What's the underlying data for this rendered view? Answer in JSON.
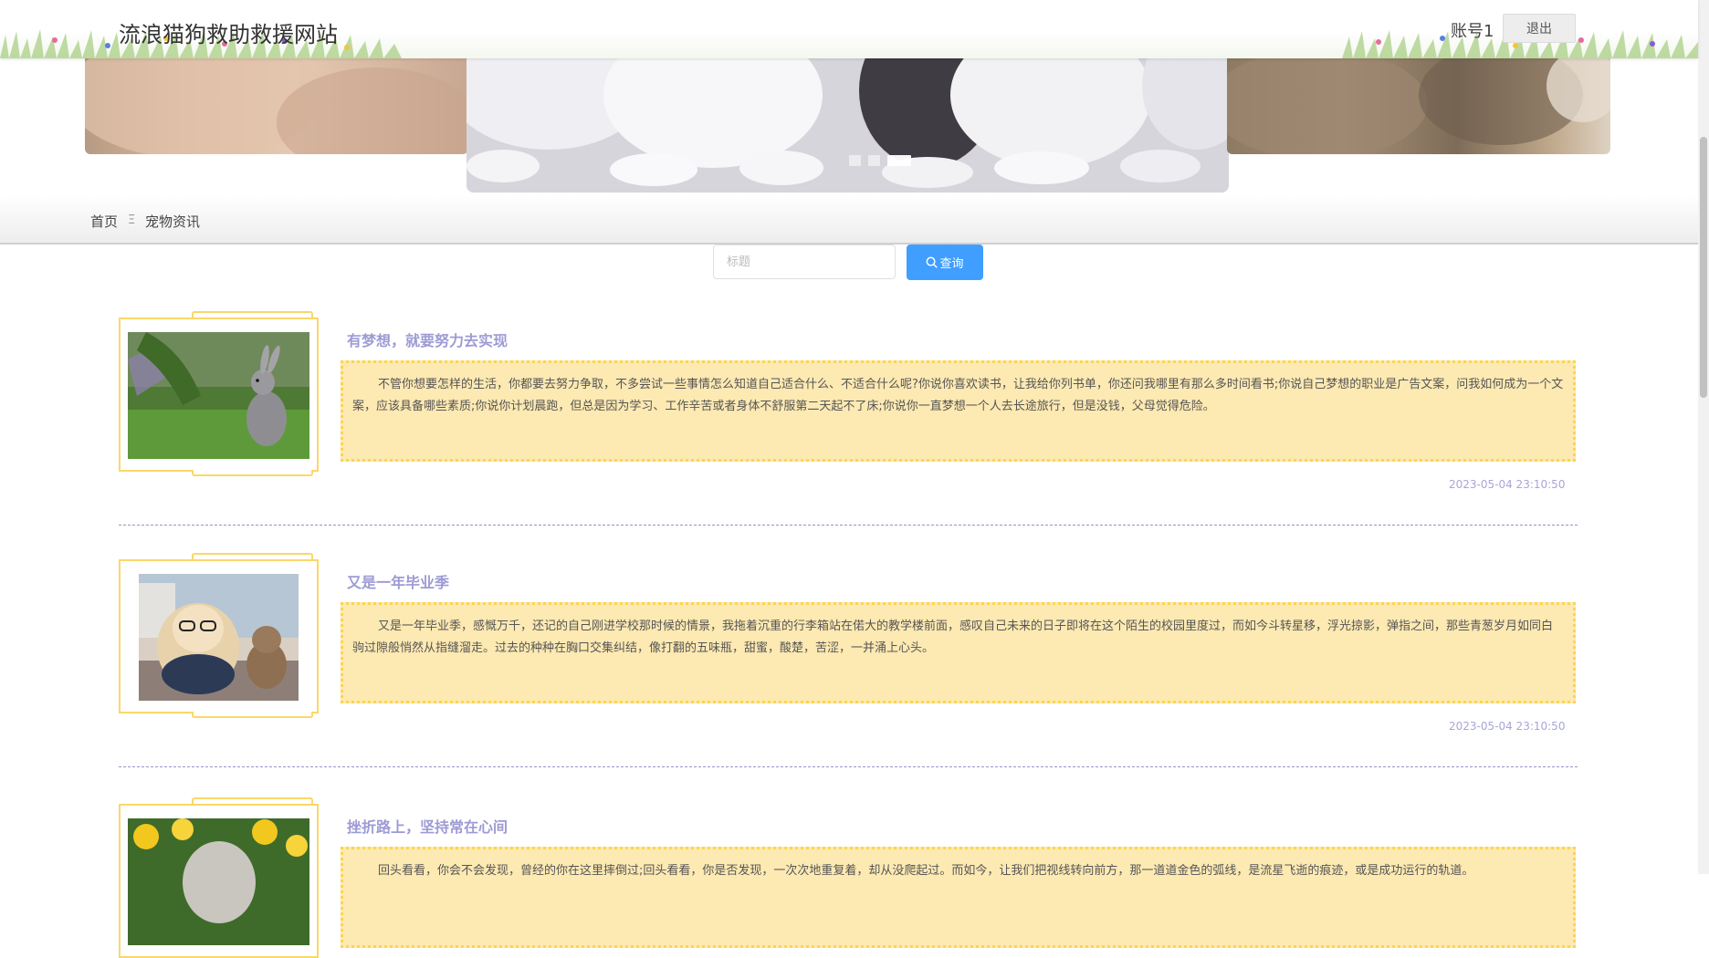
{
  "header": {
    "site_title": "流浪猫狗救助救援网站",
    "account": "账号1",
    "logout_label": "退出"
  },
  "carousel": {
    "slide_count": 3,
    "active_slide": 3
  },
  "breadcrumb": {
    "home": "首页",
    "separator": "Ξ",
    "current": "宠物资讯"
  },
  "search": {
    "placeholder": "标题",
    "value": "",
    "button_label": "查询",
    "button_color": "#409eff"
  },
  "news": [
    {
      "title": "有梦想，就要努力去实现",
      "summary": "不管你想要怎样的生活，你都要去努力争取，不多尝试一些事情怎么知道自己适合什么、不适合什么呢?你说你喜欢读书，让我给你列书单，你还问我哪里有那么多时间看书;你说自己梦想的职业是广告文案，问我如何成为一个文案，应该具备哪些素质;你说你计划晨跑，但总是因为学习、工作辛苦或者身体不舒服第二天起不了床;你说你一直梦想一个人去长途旅行，但是没钱，父母觉得危险。",
      "date": "2023-05-04 23:10:50",
      "image": "rabbit-photo"
    },
    {
      "title": "又是一年毕业季",
      "summary": "又是一年毕业季，感慨万千，还记的自己刚进学校那时候的情景，我拖着沉重的行李箱站在偌大的教学楼前面，感叹自己未来的日子即将在这个陌生的校园里度过，而如今斗转星移，浮光掠影，弹指之间，那些青葱岁月如同白驹过隙般悄然从指缝溜走。过去的种种在胸口交集纠结，像打翻的五味瓶，甜蜜，酸楚，苦涩，一并涌上心头。",
      "date": "2023-05-04 23:10:50",
      "image": "dog-and-cat-photo"
    },
    {
      "title": "挫折路上，坚持常在心间",
      "summary": "回头看看，你会不会发现，曾经的你在这里摔倒过;回头看看，你是否发现，一次次地重复着，却从没爬起过。而如今，让我们把视线转向前方，那一道道金色的弧线，是流星飞逝的痕迹，或是成功运行的轨道。",
      "date": "",
      "image": "cat-with-daffodils-photo"
    }
  ],
  "colors": {
    "title_color": "#9d9bd3",
    "summary_bg": "#fde9b2",
    "frame_border": "#fbd769",
    "divider": "#9794c9"
  }
}
